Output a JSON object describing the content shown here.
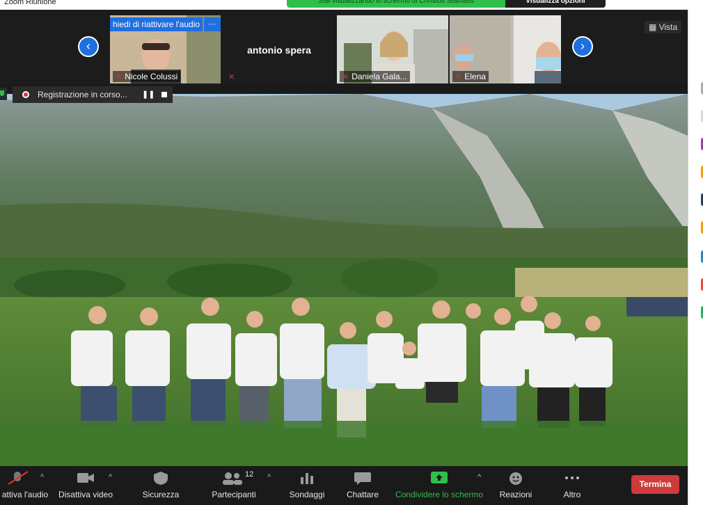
{
  "window": {
    "title": "Zoom Riunione"
  },
  "share_banner": {
    "text": "Stai visualizzando lo schermo di Christos Stamatis",
    "options": "Visualizza opzioni"
  },
  "strip": {
    "unmute_request": "hiedi di riattivare l'audio",
    "more": "···",
    "participants": [
      {
        "name": "Nicole Colussi",
        "muted": true
      },
      {
        "name": "antonio spera",
        "muted": true
      },
      {
        "name": "Daniela Gala...",
        "muted": true
      },
      {
        "name": "Elena",
        "muted": true
      },
      {
        "name": "",
        "muted": false
      }
    ],
    "view_label": "Vista"
  },
  "recording": {
    "label": "Registrazione in corso..."
  },
  "toolbar": {
    "audio_label": "attiva l'audio",
    "video_label": "Disattiva video",
    "security_label": "Sicurezza",
    "participants_label": "Partecipanti",
    "participants_count": "12",
    "polls_label": "Sondaggi",
    "chat_label": "Chattare",
    "share_label": "Condividere lo schermo",
    "reactions_label": "Reazioni",
    "more_label": "Altro",
    "end_label": "Termina"
  },
  "colors": {
    "accent": "#1f6fe0",
    "share_green": "#2fbf4a",
    "end_red": "#d03a3a",
    "muted_red": "#e0322f"
  },
  "icons": [
    "mic-muted-icon",
    "video-icon",
    "shield-icon",
    "participants-icon",
    "polls-icon",
    "chat-icon",
    "share-screen-icon",
    "reactions-icon",
    "more-icon",
    "record-icon",
    "pause-icon",
    "stop-icon",
    "arrow-left-icon",
    "arrow-right-icon",
    "grid-icon"
  ]
}
